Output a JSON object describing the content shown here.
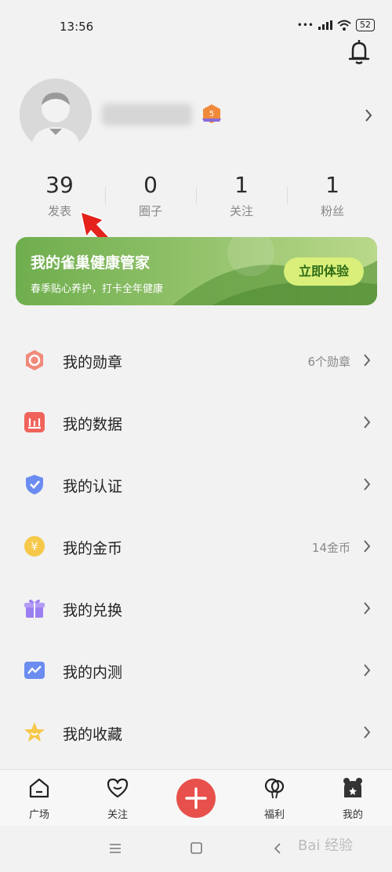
{
  "status": {
    "time": "13:56",
    "battery": "52"
  },
  "profile": {
    "level": "5"
  },
  "stats": [
    {
      "num": "39",
      "label": "发表"
    },
    {
      "num": "0",
      "label": "圈子"
    },
    {
      "num": "1",
      "label": "关注"
    },
    {
      "num": "1",
      "label": "粉丝"
    }
  ],
  "banner": {
    "title": "我的雀巢健康管家",
    "subtitle": "春季贴心养护，打卡全年健康",
    "button": "立即体验"
  },
  "menu": [
    {
      "label": "我的勋章",
      "value": "6个勋章",
      "icon": "badge-icon",
      "color": "#f08a7a"
    },
    {
      "label": "我的数据",
      "value": "",
      "icon": "data-chart-icon",
      "color": "#f0625a"
    },
    {
      "label": "我的认证",
      "value": "",
      "icon": "shield-check-icon",
      "color": "#6b8cf0"
    },
    {
      "label": "我的金币",
      "value": "14金币",
      "icon": "coin-icon",
      "color": "#f6c84a"
    },
    {
      "label": "我的兑换",
      "value": "",
      "icon": "gift-icon",
      "color": "#9b7ff0"
    },
    {
      "label": "我的内测",
      "value": "",
      "icon": "trend-icon",
      "color": "#6b8cf0"
    },
    {
      "label": "我的收藏",
      "value": "",
      "icon": "star-icon",
      "color": "#f6c84a"
    }
  ],
  "tabs": [
    {
      "label": "广场",
      "icon": "home-icon"
    },
    {
      "label": "关注",
      "icon": "heart-icon"
    },
    {
      "label": "福利",
      "icon": "balloon-icon"
    },
    {
      "label": "我的",
      "icon": "bear-icon"
    }
  ],
  "watermark": "Bai 经验"
}
